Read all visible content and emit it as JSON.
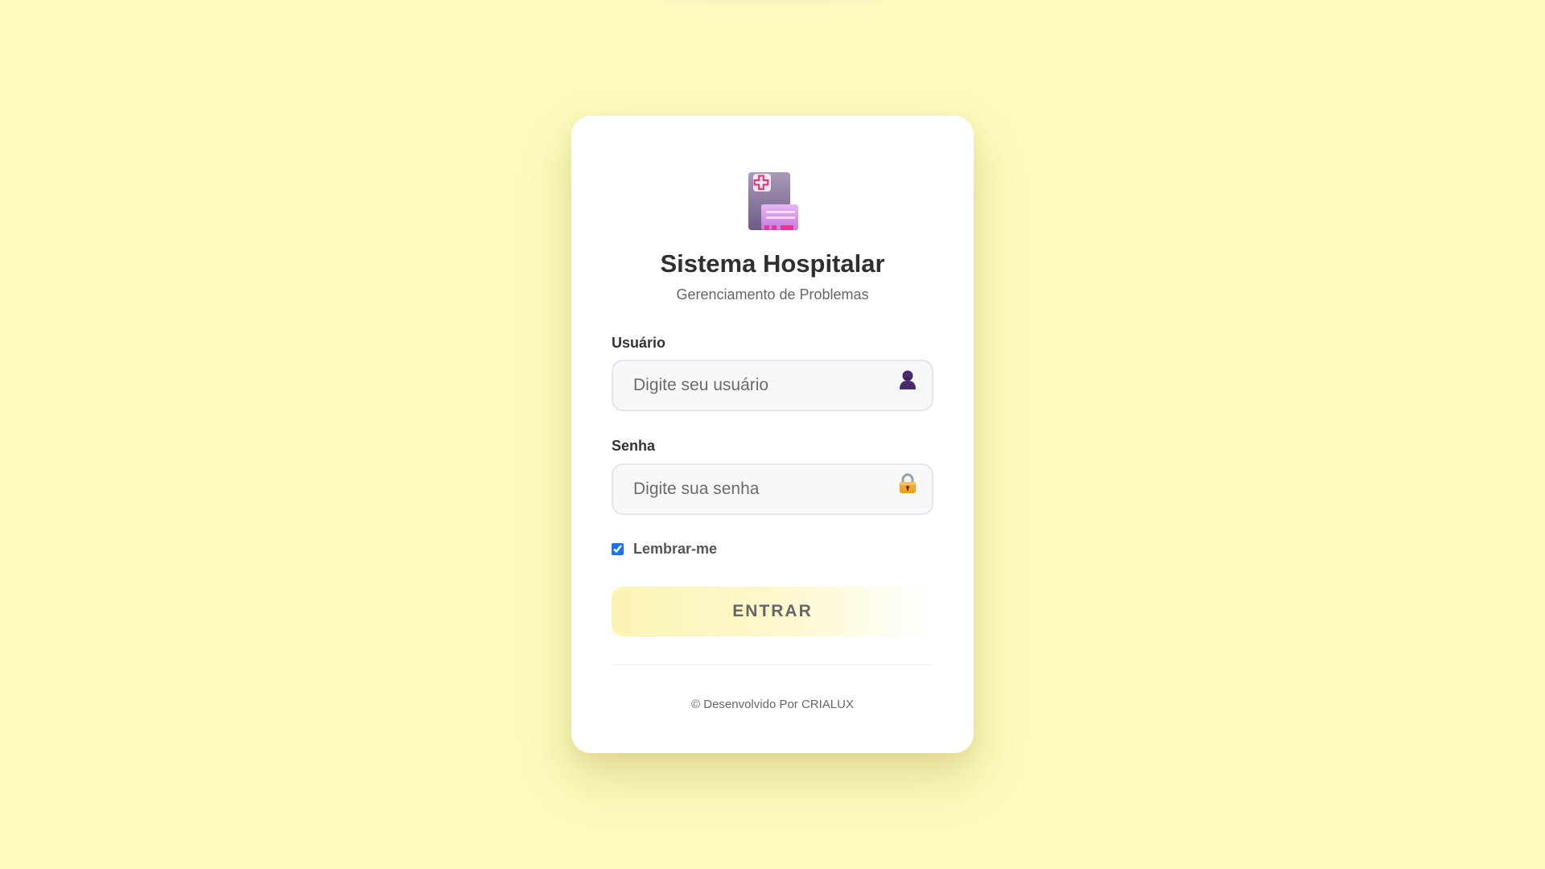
{
  "app": {
    "title": "Sistema Hospitalar",
    "subtitle": "Gerenciamento de Problemas",
    "logo_icon": "hospital-icon"
  },
  "form": {
    "user_label": "Usuário",
    "user_placeholder": "Digite seu usuário",
    "user_icon": "person-icon",
    "password_label": "Senha",
    "password_placeholder": "Digite sua senha",
    "password_icon": "lock-icon",
    "remember_label": "Lembrar-me",
    "remember_checked": true,
    "submit_label": "ENTRAR"
  },
  "footer": {
    "text": "© Desenvolvido Por CRIALUX"
  },
  "colors": {
    "background": "#fef9bd",
    "card": "#ffffff",
    "button_gradient_start": "#fcf4b4",
    "checkbox_accent": "#1a73e8"
  }
}
